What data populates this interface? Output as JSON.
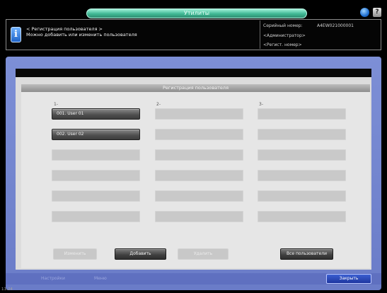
{
  "top_bar": {
    "tab_label": "Утилиты",
    "globe_icon": "globe-icon",
    "help_label": "?"
  },
  "header": {
    "info_icon_label": "i",
    "line1": "< Регистрация пользователя >",
    "line2": "Можно добавить или изменить пользователя",
    "serial_label": "Серийный номер:",
    "serial_value": "A4EW021000001",
    "admin_label": "<Администратор>",
    "mode_label": "<Регист. номер>"
  },
  "panel": {
    "title": "Регистрация пользователя",
    "column_markers": [
      "1-",
      "2-",
      "3-"
    ],
    "columns": [
      [
        "001. User 01",
        "002. User 02",
        "",
        "",
        "",
        ""
      ],
      [
        "",
        "",
        "",
        "",
        "",
        ""
      ],
      [
        "",
        "",
        "",
        "",
        "",
        ""
      ]
    ]
  },
  "buttons": {
    "edit": "Изменить",
    "add": "Добавить",
    "delete": "Удалить",
    "all_users": "Все пользователи"
  },
  "footer": {
    "tab1": "Настройки",
    "tab2": "Меню",
    "close": "Закрыть",
    "clock": "11:24"
  }
}
